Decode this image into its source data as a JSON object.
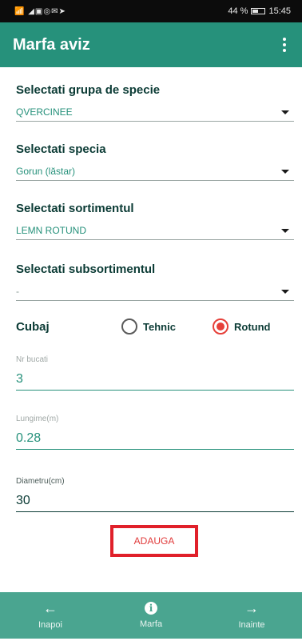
{
  "status_bar": {
    "left_icons": "📶 ◢▣◎✉➤",
    "battery_percent": "44 %",
    "time": "15:45",
    "battery_level": 0.44
  },
  "app_bar": {
    "title": "Marfa aviz",
    "menu_icon": "more-vert-icon"
  },
  "form": {
    "species_group": {
      "label": "Selectati grupa de specie",
      "value": "QVERCINEE"
    },
    "species": {
      "label": "Selectati specia",
      "value": "Gorun (lăstar)"
    },
    "assortment": {
      "label": "Selectati sortimentul",
      "value": "LEMN ROTUND"
    },
    "subassortment": {
      "label": "Selectati subsortimentul",
      "value": "-"
    },
    "cubaj": {
      "label": "Cubaj",
      "options": [
        {
          "label": "Tehnic",
          "selected": false
        },
        {
          "label": "Rotund",
          "selected": true
        }
      ]
    },
    "pieces": {
      "placeholder": "Nr bucati",
      "value": "3"
    },
    "length": {
      "placeholder": "Lungime(m)",
      "value": "0.28"
    },
    "diameter": {
      "placeholder": "Diametru(cm)",
      "value": "30"
    },
    "add_button": "ADAUGA"
  },
  "bottom_nav": [
    {
      "label": "Inapoi",
      "icon": "arrow-left-icon"
    },
    {
      "label": "Marfa",
      "icon": "info-icon"
    },
    {
      "label": "Inainte",
      "icon": "arrow-right-icon"
    }
  ],
  "colors": {
    "primary": "#26917b",
    "accent": "#e6403a",
    "nav": "#4aa590"
  }
}
